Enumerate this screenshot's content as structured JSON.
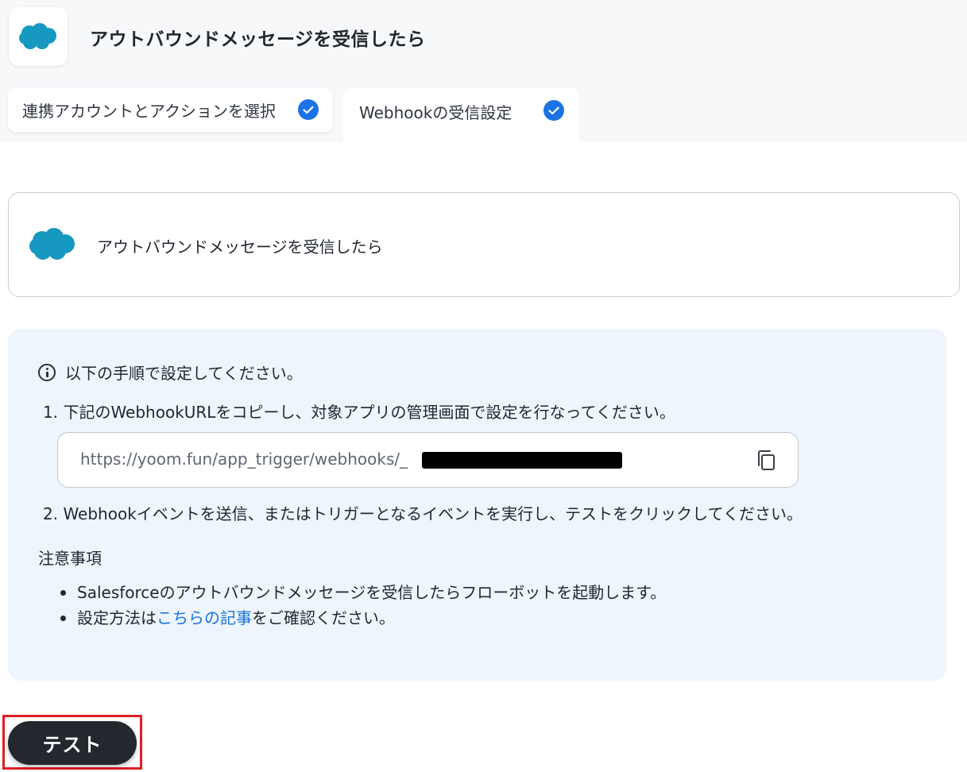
{
  "header": {
    "title": "アウトバウンドメッセージを受信したら",
    "app_icon": "salesforce-cloud-icon",
    "brand_color": "#1798c1"
  },
  "tabs": [
    {
      "label": "連携アカウントとアクションを選択",
      "completed": true
    },
    {
      "label": "Webhookの受信設定",
      "completed": true,
      "active": true
    }
  ],
  "app_card": {
    "title": "アウトバウンドメッセージを受信したら"
  },
  "info": {
    "heading": "以下の手順で設定してください。",
    "step1": "1. 下記のWebhookURLをコピーし、対象アプリの管理画面で設定を行なってください。",
    "webhook_url": "https://yoom.fun/app_trigger/webhooks/_",
    "step2": "2. Webhookイベントを送信、またはトリガーとなるイベントを実行し、テストをクリックしてください。",
    "notes_title": "注意事項",
    "note1": "Salesforceのアウトバウンドメッセージを受信したらフローボットを起動します。",
    "note2_prefix": "設定方法は",
    "note2_link": "こちらの記事",
    "note2_suffix": "をご確認ください。"
  },
  "actions": {
    "test_label": "テスト"
  },
  "colors": {
    "accent": "#1d73e6",
    "panel_bg": "#eef5fd",
    "link": "#1a73d9",
    "highlight": "#e11d24"
  }
}
